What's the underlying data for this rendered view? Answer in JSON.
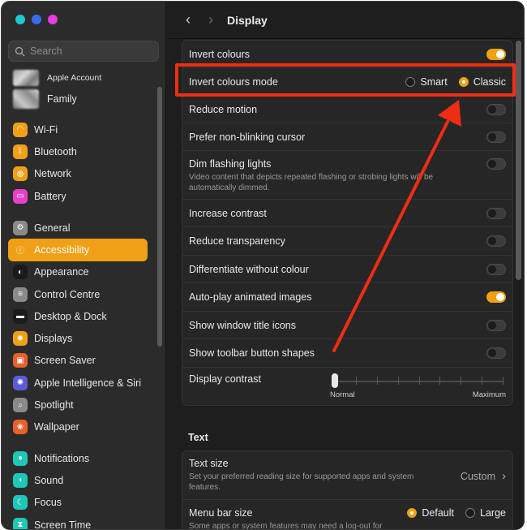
{
  "window": {
    "traffic_colors": [
      "#1fc7cf",
      "#3b6cf0",
      "#e43ee0"
    ]
  },
  "sidebar": {
    "search_placeholder": "Search",
    "account_label": "Apple Account",
    "family_label": "Family",
    "items": [
      {
        "label": "Wi-Fi",
        "icon": "wifi-icon",
        "color": "#f0a016",
        "glyph": "◠"
      },
      {
        "label": "Bluetooth",
        "icon": "bluetooth-icon",
        "color": "#f0a016",
        "glyph": "ᛒ"
      },
      {
        "label": "Network",
        "icon": "globe-icon",
        "color": "#f0a016",
        "glyph": "◍"
      },
      {
        "label": "Battery",
        "icon": "battery-icon",
        "color": "#e840c8",
        "glyph": "▭"
      },
      {
        "label": "General",
        "icon": "gear-icon",
        "color": "#8a8a8a",
        "glyph": "⚙"
      },
      {
        "label": "Accessibility",
        "icon": "accessibility-icon",
        "color": "#f0a016",
        "glyph": "ⓘ",
        "active": true
      },
      {
        "label": "Appearance",
        "icon": "appearance-icon",
        "color": "#1b1b1b",
        "glyph": "◐"
      },
      {
        "label": "Control Centre",
        "icon": "control-centre-icon",
        "color": "#8a8a8a",
        "glyph": "≡"
      },
      {
        "label": "Desktop & Dock",
        "icon": "dock-icon",
        "color": "#1b1b1b",
        "glyph": "▬"
      },
      {
        "label": "Displays",
        "icon": "displays-icon",
        "color": "#f0a016",
        "glyph": "✹"
      },
      {
        "label": "Screen Saver",
        "icon": "screen-saver-icon",
        "color": "#e8602a",
        "glyph": "▣"
      },
      {
        "label": "Apple Intelligence & Siri",
        "icon": "siri-icon",
        "color": "#5b5bd6",
        "glyph": "✺"
      },
      {
        "label": "Spotlight",
        "icon": "spotlight-icon",
        "color": "#8a8a8a",
        "glyph": "⌕"
      },
      {
        "label": "Wallpaper",
        "icon": "wallpaper-icon",
        "color": "#e8602a",
        "glyph": "❀"
      },
      {
        "label": "Notifications",
        "icon": "notifications-icon",
        "color": "#1fc7b8",
        "glyph": "●"
      },
      {
        "label": "Sound",
        "icon": "sound-icon",
        "color": "#1fc7b8",
        "glyph": "◖"
      },
      {
        "label": "Focus",
        "icon": "focus-icon",
        "color": "#1fc7b8",
        "glyph": "☾"
      },
      {
        "label": "Screen Time",
        "icon": "screen-time-icon",
        "color": "#1fc7b8",
        "glyph": "⧗"
      }
    ]
  },
  "toolbar": {
    "back": "‹",
    "forward": "›",
    "title": "Display"
  },
  "display_group": {
    "invert_colours": {
      "label": "Invert colours",
      "on": true
    },
    "invert_mode": {
      "label": "Invert colours mode",
      "option_smart": "Smart",
      "option_classic": "Classic",
      "selected": "Classic"
    },
    "reduce_motion": {
      "label": "Reduce motion",
      "on": false
    },
    "prefer_nonblinking": {
      "label": "Prefer non-blinking cursor",
      "on": false
    },
    "dim_flashing": {
      "label": "Dim flashing lights",
      "desc": "Video content that depicts repeated flashing or strobing lights will be automatically dimmed.",
      "on": false
    },
    "increase_contrast": {
      "label": "Increase contrast",
      "on": false
    },
    "reduce_transparency": {
      "label": "Reduce transparency",
      "on": false
    },
    "differentiate": {
      "label": "Differentiate without colour",
      "on": false
    },
    "autoplay": {
      "label": "Auto-play animated images",
      "on": true
    },
    "window_title_icons": {
      "label": "Show window title icons",
      "on": false
    },
    "toolbar_shapes": {
      "label": "Show toolbar button shapes",
      "on": false
    },
    "display_contrast": {
      "label": "Display contrast",
      "min_label": "Normal",
      "max_label": "Maximum",
      "value": 0
    }
  },
  "text_section": {
    "title": "Text",
    "text_size": {
      "label": "Text size",
      "desc": "Set your preferred reading size for supported apps and system features.",
      "value": "Custom",
      "chevron": "›"
    },
    "menu_bar_size": {
      "label": "Menu bar size",
      "desc": "Some apps or system features may need a log-out for",
      "option_default": "Default",
      "option_large": "Large",
      "selected": "Default"
    }
  },
  "annotation": {
    "highlight_color": "#ef2d14"
  }
}
